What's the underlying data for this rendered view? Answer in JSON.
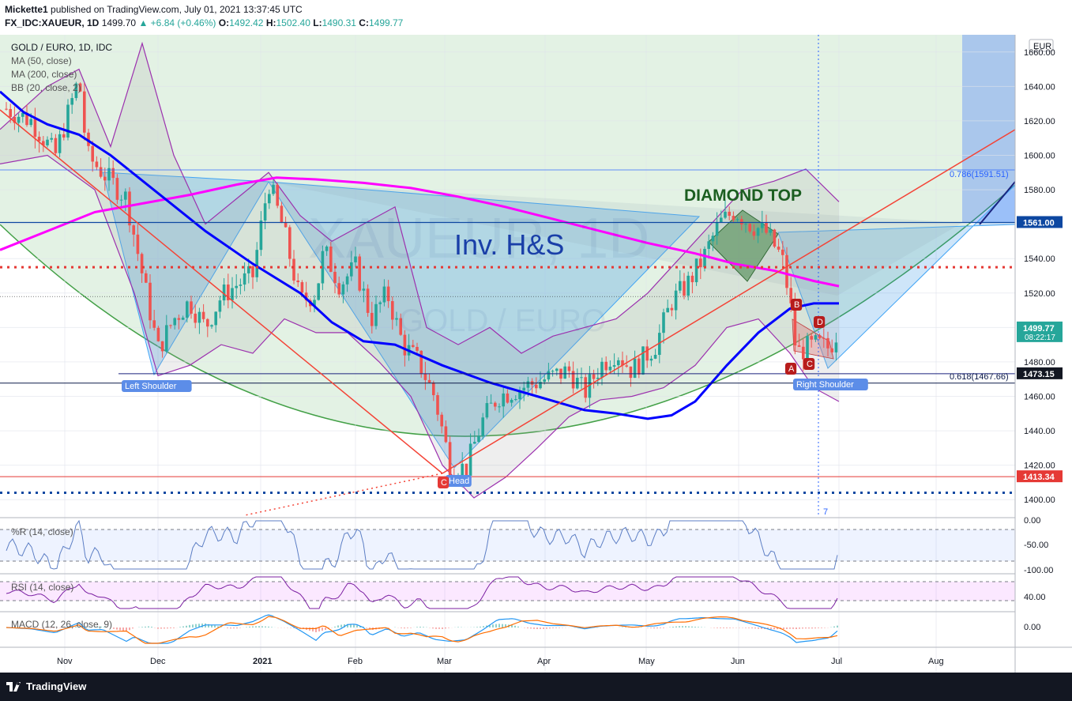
{
  "header": {
    "publisher": "Mickette1",
    "published_text": "published on TradingView.com, July 01, 2021 13:37:45 UTC",
    "symbol": "FX_IDC:XAUEUR, 1D",
    "last": "1499.70",
    "change": "+6.84 (+0.46%)",
    "o_label": "O:",
    "o": "1492.42",
    "h_label": "H:",
    "h": "1502.40",
    "l_label": "L:",
    "l": "1490.31",
    "c_label": "C:",
    "c": "1499.77"
  },
  "footer": {
    "brand": "TradingView"
  },
  "legend": {
    "title": "GOLD / EURO, 1D, IDC",
    "ma50": "MA (50, close)",
    "ma200": "MA (200, close)",
    "bb": "BB (20, close, 2)"
  },
  "annotations": {
    "watermark": "XAUEUR, 1D",
    "watermark_sub": "GOLD / EURO",
    "inv_hs": "Inv. H&S",
    "diamond": "DIAMOND TOP",
    "left_shoulder": "Left Shoulder",
    "head": "Head",
    "right_shoulder": "Right Shoulder",
    "fib_786": "0.786(1591.51)",
    "fib_618": "0.618(1467.66)",
    "marker_c": "C",
    "abcd": [
      "A",
      "B",
      "C",
      "D"
    ],
    "count_7": "7"
  },
  "colors": {
    "up": "#26a69a",
    "down": "#ef5350",
    "ma50": "#0000ff",
    "ma200": "#ff00ff",
    "bb": "#9c27b0",
    "trend": "#f44336",
    "arc": "#43a047",
    "hline_blue": "#0d47a1",
    "hline_red": "#e53935",
    "accent": "#2962ff"
  },
  "chart_data": {
    "type": "candlestick",
    "title": "GOLD / EURO, 1D, IDC",
    "currency": "EUR",
    "ylim": [
      1390,
      1670
    ],
    "yticks": [
      "1660.00",
      "1640.00",
      "1620.00",
      "1600.00",
      "1580.00",
      "1560.00",
      "1540.00",
      "1520.00",
      "1500.00",
      "1480.00",
      "1460.00",
      "1440.00",
      "1420.00",
      "1400.00"
    ],
    "xticks": [
      "Nov",
      "Dec",
      "2021",
      "Feb",
      "Mar",
      "Apr",
      "May",
      "Jun",
      "Jul",
      "Aug"
    ],
    "price_labels": [
      {
        "value": 1561.0,
        "text": "1561.00",
        "color": "#0d47a1"
      },
      {
        "value": 1499.77,
        "text": "1499.77",
        "sub": "08:22:17",
        "color": "#26a69a"
      },
      {
        "value": 1473.15,
        "text": "1473.15",
        "color": "#131722"
      },
      {
        "value": 1413.34,
        "text": "1413.34",
        "color": "#e53935"
      }
    ],
    "levels": {
      "top_line": 1591.51,
      "neckline": 1561.0,
      "red_dotted": 1535.0,
      "fib618": 1467.66,
      "shoulder_line": 1473.15,
      "head_low": 1413.34,
      "blue_dotted": 1404.0
    },
    "ma50_points": [
      [
        0,
        1637
      ],
      [
        30,
        1625
      ],
      [
        60,
        1618
      ],
      [
        100,
        1612
      ],
      [
        140,
        1600
      ],
      [
        200,
        1578
      ],
      [
        260,
        1556
      ],
      [
        320,
        1537
      ],
      [
        380,
        1520
      ],
      [
        420,
        1503
      ],
      [
        460,
        1492
      ],
      [
        500,
        1490
      ],
      [
        560,
        1478
      ],
      [
        620,
        1468
      ],
      [
        680,
        1460
      ],
      [
        740,
        1452
      ],
      [
        780,
        1450
      ],
      [
        820,
        1447
      ],
      [
        850,
        1449
      ],
      [
        880,
        1457
      ],
      [
        920,
        1478
      ],
      [
        960,
        1497
      ],
      [
        1000,
        1511
      ],
      [
        1030,
        1514
      ],
      [
        1062,
        1514
      ]
    ],
    "ma200_points": [
      [
        0,
        1545
      ],
      [
        60,
        1556
      ],
      [
        120,
        1567
      ],
      [
        180,
        1572
      ],
      [
        240,
        1577
      ],
      [
        300,
        1583
      ],
      [
        350,
        1587
      ],
      [
        400,
        1586
      ],
      [
        460,
        1584
      ],
      [
        520,
        1581
      ],
      [
        580,
        1576
      ],
      [
        640,
        1570
      ],
      [
        700,
        1563
      ],
      [
        760,
        1556
      ],
      [
        820,
        1549
      ],
      [
        880,
        1543
      ],
      [
        930,
        1537
      ],
      [
        980,
        1533
      ],
      [
        1030,
        1527
      ],
      [
        1062,
        1524
      ]
    ],
    "bb_upper_points": [
      [
        0,
        1615
      ],
      [
        60,
        1640
      ],
      [
        100,
        1650
      ],
      [
        140,
        1605
      ],
      [
        180,
        1665
      ],
      [
        220,
        1600
      ],
      [
        260,
        1560
      ],
      [
        300,
        1575
      ],
      [
        340,
        1590
      ],
      [
        380,
        1565
      ],
      [
        420,
        1550
      ],
      [
        460,
        1560
      ],
      [
        500,
        1570
      ],
      [
        540,
        1500
      ],
      [
        580,
        1490
      ],
      [
        620,
        1500
      ],
      [
        660,
        1485
      ],
      [
        700,
        1495
      ],
      [
        740,
        1500
      ],
      [
        780,
        1505
      ],
      [
        820,
        1520
      ],
      [
        860,
        1540
      ],
      [
        900,
        1560
      ],
      [
        940,
        1580
      ],
      [
        980,
        1585
      ],
      [
        1020,
        1592
      ],
      [
        1062,
        1573
      ]
    ],
    "bb_lower_points": [
      [
        0,
        1595
      ],
      [
        60,
        1600
      ],
      [
        120,
        1580
      ],
      [
        170,
        1520
      ],
      [
        200,
        1472
      ],
      [
        240,
        1478
      ],
      [
        280,
        1490
      ],
      [
        320,
        1485
      ],
      [
        360,
        1505
      ],
      [
        400,
        1497
      ],
      [
        440,
        1497
      ],
      [
        480,
        1480
      ],
      [
        520,
        1460
      ],
      [
        560,
        1420
      ],
      [
        600,
        1401
      ],
      [
        640,
        1413
      ],
      [
        680,
        1430
      ],
      [
        720,
        1448
      ],
      [
        760,
        1458
      ],
      [
        800,
        1460
      ],
      [
        840,
        1465
      ],
      [
        880,
        1478
      ],
      [
        920,
        1500
      ],
      [
        960,
        1505
      ],
      [
        1000,
        1485
      ],
      [
        1030,
        1465
      ],
      [
        1062,
        1457
      ]
    ],
    "close_path": [
      [
        8,
        1627
      ],
      [
        40,
        1620
      ],
      [
        70,
        1600
      ],
      [
        100,
        1645
      ],
      [
        110,
        1600
      ],
      [
        130,
        1590
      ],
      [
        160,
        1575
      ],
      [
        185,
        1520
      ],
      [
        200,
        1487
      ],
      [
        220,
        1505
      ],
      [
        240,
        1515
      ],
      [
        260,
        1500
      ],
      [
        280,
        1518
      ],
      [
        300,
        1525
      ],
      [
        320,
        1530
      ],
      [
        340,
        1585
      ],
      [
        360,
        1555
      ],
      [
        380,
        1515
      ],
      [
        400,
        1520
      ],
      [
        410,
        1545
      ],
      [
        430,
        1525
      ],
      [
        450,
        1535
      ],
      [
        470,
        1505
      ],
      [
        490,
        1520
      ],
      [
        510,
        1490
      ],
      [
        530,
        1480
      ],
      [
        550,
        1460
      ],
      [
        570,
        1420
      ],
      [
        590,
        1418
      ],
      [
        610,
        1445
      ],
      [
        630,
        1460
      ],
      [
        660,
        1465
      ],
      [
        690,
        1470
      ],
      [
        720,
        1475
      ],
      [
        740,
        1462
      ],
      [
        760,
        1478
      ],
      [
        780,
        1486
      ],
      [
        800,
        1475
      ],
      [
        830,
        1490
      ],
      [
        850,
        1515
      ],
      [
        870,
        1525
      ],
      [
        890,
        1540
      ],
      [
        910,
        1560
      ],
      [
        930,
        1568
      ],
      [
        950,
        1560
      ],
      [
        970,
        1555
      ],
      [
        990,
        1540
      ],
      [
        1000,
        1515
      ],
      [
        1008,
        1485
      ],
      [
        1020,
        1488
      ],
      [
        1035,
        1490
      ],
      [
        1050,
        1488
      ],
      [
        1062,
        1500
      ]
    ],
    "oscillators": {
      "willr": {
        "label": "%R (14, close)",
        "ticks": [
          "0.00",
          "-50.00",
          "-100.00"
        ]
      },
      "rsi": {
        "label": "RSI (14, close)",
        "ticks": [
          "40.00"
        ]
      },
      "macd": {
        "label": "MACD (12, 26, close, 9)",
        "ticks": [
          "0.00"
        ]
      }
    }
  }
}
